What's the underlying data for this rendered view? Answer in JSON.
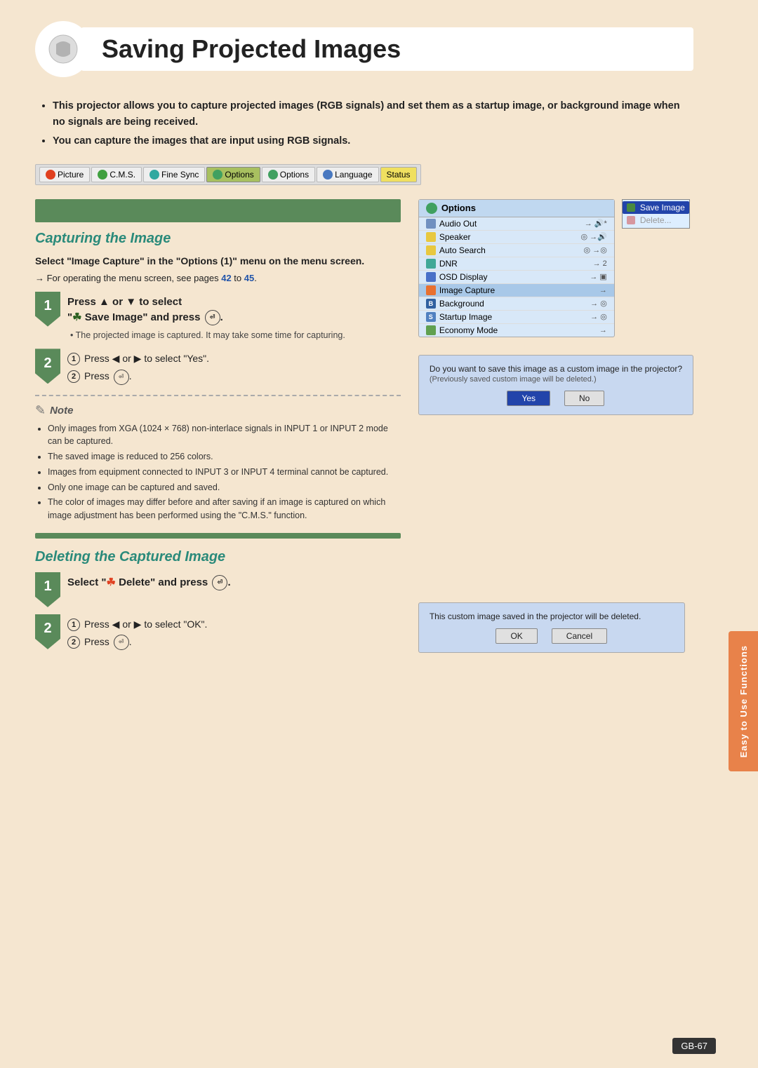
{
  "page": {
    "title": "Saving Projected Images",
    "page_number": "GB-67",
    "right_tab_label": "Easy to Use Functions"
  },
  "intro": {
    "bullet1": "This projector allows you to capture projected images (RGB signals) and set them as a startup image, or background image when no signals are being received.",
    "bullet2": "You can capture the images that are input using RGB signals."
  },
  "menu_bar": {
    "items": [
      {
        "label": "Picture",
        "color": "red",
        "active": false
      },
      {
        "label": "C.M.S.",
        "color": "green",
        "active": false
      },
      {
        "label": "Fine Sync",
        "color": "teal",
        "active": false
      },
      {
        "label": "Options",
        "color": "green",
        "active": true
      },
      {
        "label": "Options",
        "color": "green",
        "active": false
      },
      {
        "label": "Language",
        "color": "blue",
        "active": false
      },
      {
        "label": "Status",
        "color": "yellow",
        "active": false,
        "status": true
      }
    ]
  },
  "capture_section": {
    "header": "Capturing the Image",
    "step_bold": "Select \"Image Capture\" in the \"Options (1)\" menu on the menu screen.",
    "arrow_note": "→ For operating the menu screen, see pages 42 to 45.",
    "step1": {
      "num": "1",
      "text_main": "Press ▲ or ▼ to select",
      "text_sub": "\" Save Image\" and press",
      "bullet": "The projected image is captured. It may take some time for capturing."
    },
    "step2": {
      "num": "2",
      "sub1_text": "Press ◀ or ▶ to select \"Yes\".",
      "sub2_text": "Press"
    }
  },
  "note": {
    "label": "Note",
    "bullets": [
      "Only images from XGA (1024 × 768) non-interlace signals in INPUT 1 or INPUT 2 mode can be captured.",
      "The saved image is reduced to 256 colors.",
      "Images from equipment connected to INPUT 3 or INPUT 4 terminal cannot be captured.",
      "Only one image can be captured and saved.",
      "The color of images may differ before and after saving if an image is captured on which image adjustment has been performed using the \"C.M.S.\" function."
    ]
  },
  "options_menu": {
    "title": "Options",
    "rows": [
      {
        "label": "Audio Out",
        "icon": "speaker",
        "arrow": "→ 🔊",
        "highlighted": false
      },
      {
        "label": "Speaker",
        "icon": "yellow",
        "arrow": "→ 🔊",
        "highlighted": false
      },
      {
        "label": "Auto Search",
        "icon": "yellow",
        "arrow": "→ ◎",
        "highlighted": false
      },
      {
        "label": "DNR",
        "icon": "teal",
        "arrow": "→ 2",
        "highlighted": false
      },
      {
        "label": "OSD Display",
        "icon": "blue",
        "arrow": "→ ▣",
        "highlighted": false
      },
      {
        "label": "Image Capture",
        "icon": "orange",
        "arrow": "→",
        "highlighted": true
      },
      {
        "label": "Background",
        "icon": "brown-b",
        "arrow": "→ ◎",
        "highlighted": false
      },
      {
        "label": "Startup Image",
        "icon": "blue-s",
        "arrow": "→ ◎",
        "highlighted": false
      },
      {
        "label": "Economy Mode",
        "icon": "green-eco",
        "arrow": "→",
        "highlighted": false
      }
    ]
  },
  "save_popup": {
    "items": [
      {
        "label": "Save Image",
        "selected": true
      },
      {
        "label": "Delete...",
        "selected": false,
        "disabled": true
      }
    ]
  },
  "confirm_dialog": {
    "message1": "Do you want to save this image as a custom image in the projector?",
    "message2": "(Previously saved custom image will be deleted.)",
    "btn_yes": "Yes",
    "btn_no": "No"
  },
  "delete_section": {
    "header": "Deleting the Captured Image",
    "step1": {
      "num": "1",
      "text": "Select \" Delete\" and press"
    },
    "step2": {
      "num": "2",
      "sub1_text": "Press ◀ or ▶ to select \"OK\".",
      "sub2_text": "Press"
    }
  },
  "delete_dialog": {
    "message": "This custom image saved in the projector will be deleted.",
    "btn_ok": "OK",
    "btn_cancel": "Cancel"
  }
}
